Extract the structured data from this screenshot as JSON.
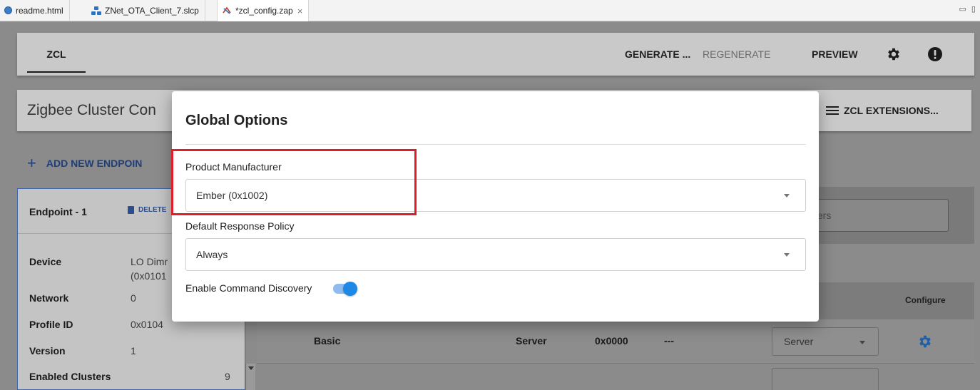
{
  "tabs": [
    {
      "label": "readme.html",
      "icon": "globe-icon"
    },
    {
      "label": "ZNet_OTA_Client_7.slcp",
      "icon": "project-icon"
    },
    {
      "label": "*zcl_config.zap",
      "icon": "zap-file-icon",
      "close": "×"
    }
  ],
  "window_controls": "▭ ▯",
  "appbar": {
    "tab": "ZCL",
    "generate": "GENERATE ...",
    "regenerate": "REGENERATE",
    "preview": "PREVIEW",
    "settings_icon": "gear-icon",
    "info_icon": "exclamation-icon"
  },
  "header": {
    "title": "Zigbee Cluster Con",
    "extensions": "ZCL EXTENSIONS..."
  },
  "add_endpoint": {
    "plus": "+",
    "label": "ADD NEW ENDPOIN"
  },
  "endpoint": {
    "title": "Endpoint - 1",
    "delete": "DELETE",
    "rows": [
      {
        "label": "Device",
        "value": "LO Dimr",
        "value2": "(0x0101"
      },
      {
        "label": "Network",
        "value": "0"
      },
      {
        "label": "Profile ID",
        "value": "0x0104"
      },
      {
        "label": "Version",
        "value": "1"
      },
      {
        "label": "Enabled Clusters",
        "value": "9"
      }
    ]
  },
  "clusters": {
    "search_placeholder": "sters",
    "configure_header": "Configure",
    "row": {
      "name": "Basic",
      "side": "Server",
      "id": "0x0000",
      "dashes": "---",
      "role": "Server"
    }
  },
  "dialog": {
    "title": "Global Options",
    "manufacturer_label": "Product Manufacturer",
    "manufacturer_value": "Ember (0x1002)",
    "response_label": "Default Response Policy",
    "response_value": "Always",
    "discovery_label": "Enable Command Discovery",
    "discovery_enabled": true
  },
  "colors": {
    "toggle_on": "#1e88e5",
    "highlight": "#e11d2a",
    "link": "#1d3f7a"
  }
}
